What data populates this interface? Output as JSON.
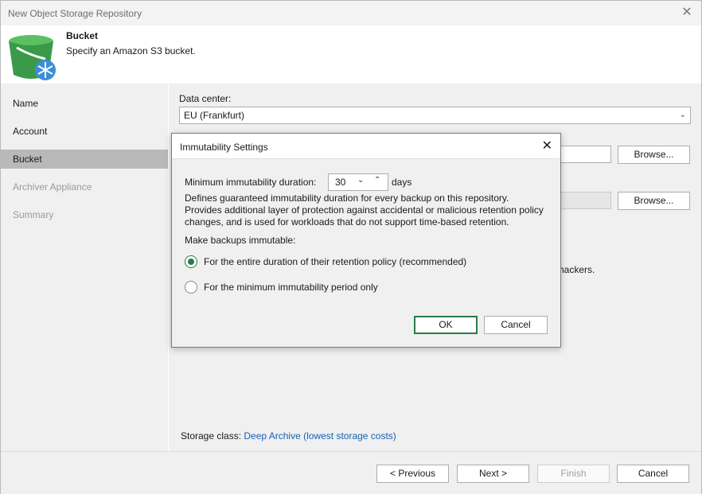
{
  "window": {
    "title": "New Object Storage Repository"
  },
  "header": {
    "title": "Bucket",
    "subtitle": "Specify an Amazon S3 bucket."
  },
  "sidebar": {
    "items": [
      {
        "label": "Name",
        "state": "normal"
      },
      {
        "label": "Account",
        "state": "normal"
      },
      {
        "label": "Bucket",
        "state": "active"
      },
      {
        "label": "Archiver Appliance",
        "state": "disabled"
      },
      {
        "label": "Summary",
        "state": "disabled"
      }
    ]
  },
  "main": {
    "datacenter_label": "Data center:",
    "datacenter_value": "EU (Frankfurt)",
    "browse_label_1": "Browse...",
    "browse_label_2": "Browse...",
    "hidden_text_fragment": "hackers.",
    "storage_class_label": "Storage class:",
    "storage_class_value": "Deep Archive (lowest storage costs)"
  },
  "footer": {
    "previous": "< Previous",
    "next": "Next >",
    "finish": "Finish",
    "cancel": "Cancel"
  },
  "dialog": {
    "title": "Immutability Settings",
    "duration_label": "Minimum immutability duration:",
    "duration_value": "30",
    "duration_unit": "days",
    "description": "Defines guaranteed immutability duration for every backup on this repository. Provides additional layer of protection against accidental or malicious retention policy changes, and is used for workloads that do not support time-based retention.",
    "desc_line1": "Defines guaranteed immutability duration for every backup on this repository.",
    "desc_line2": "Provides additional layer of protection against accidental or malicious retention policy",
    "desc_line3": "changes, and is used for workloads that do not support time-based retention.",
    "make_label": "Make backups immutable:",
    "option1": "For the entire duration of their retention policy (recommended)",
    "option2": "For the minimum immutability period only",
    "selected_option": 1,
    "ok": "OK",
    "cancel": "Cancel"
  },
  "colors": {
    "accent": "#2a7d46",
    "link": "#1a5fb4",
    "bucket": "#3a9a4a"
  }
}
